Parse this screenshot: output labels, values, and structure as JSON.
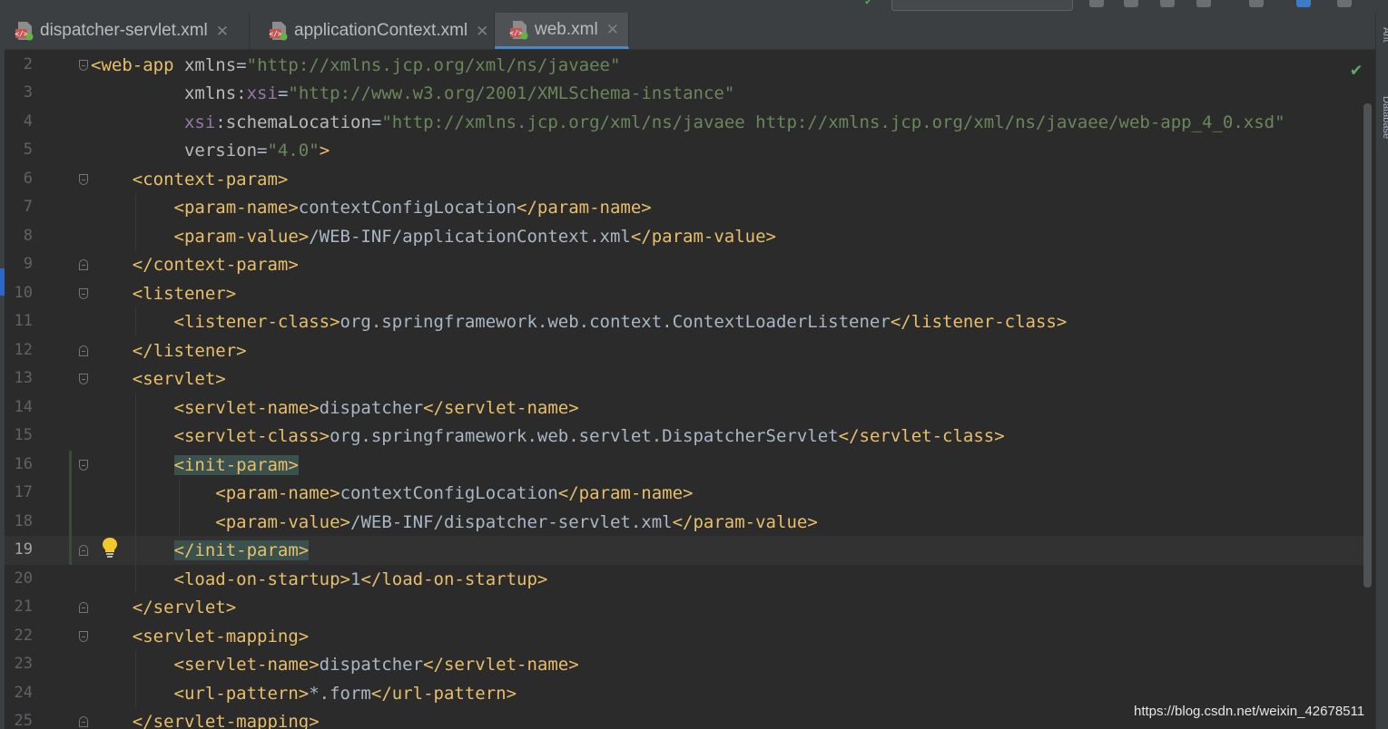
{
  "tabs": [
    {
      "label": "dispatcher-servlet.xml",
      "active": false,
      "close": "✕"
    },
    {
      "label": "applicationContext.xml",
      "active": false,
      "close": "✕"
    },
    {
      "label": "web.xml",
      "active": true,
      "close": "✕"
    }
  ],
  "right_strip": {
    "ant_label": "Ant",
    "database_label": "Database"
  },
  "editor": {
    "inspection_icon": "check-icon",
    "intention_icon": "lightbulb-icon",
    "caret_line": "19",
    "lines": [
      {
        "num": "2",
        "tokens": [
          {
            "t": "tag",
            "v": "<web-app"
          },
          {
            "t": "txt",
            "v": " "
          },
          {
            "t": "attr",
            "v": "xmlns"
          },
          {
            "t": "txt",
            "v": "="
          },
          {
            "t": "val",
            "v": "\"http://xmlns.jcp.org/xml/ns/javaee\""
          }
        ]
      },
      {
        "num": "3",
        "tokens": [
          {
            "t": "txt",
            "v": "         "
          },
          {
            "t": "attr",
            "v": "xmlns"
          },
          {
            "t": "txt",
            "v": ":"
          },
          {
            "t": "ns",
            "v": "xsi"
          },
          {
            "t": "txt",
            "v": "="
          },
          {
            "t": "val",
            "v": "\"http://www.w3.org/2001/XMLSchema-instance\""
          }
        ]
      },
      {
        "num": "4",
        "tokens": [
          {
            "t": "txt",
            "v": "         "
          },
          {
            "t": "ns",
            "v": "xsi"
          },
          {
            "t": "txt",
            "v": ":"
          },
          {
            "t": "attr",
            "v": "schemaLocation"
          },
          {
            "t": "txt",
            "v": "="
          },
          {
            "t": "val",
            "v": "\"http://xmlns.jcp.org/xml/ns/javaee http://xmlns.jcp.org/xml/ns/javaee/web-app_4_0.xsd\""
          }
        ]
      },
      {
        "num": "5",
        "tokens": [
          {
            "t": "txt",
            "v": "         "
          },
          {
            "t": "attr",
            "v": "version"
          },
          {
            "t": "txt",
            "v": "="
          },
          {
            "t": "val",
            "v": "\"4.0\""
          },
          {
            "t": "tag",
            "v": ">"
          }
        ]
      },
      {
        "num": "6",
        "tokens": [
          {
            "t": "txt",
            "v": "    "
          },
          {
            "t": "tag",
            "v": "<context-param>"
          }
        ]
      },
      {
        "num": "7",
        "tokens": [
          {
            "t": "txt",
            "v": "        "
          },
          {
            "t": "tag",
            "v": "<param-name>"
          },
          {
            "t": "txt",
            "v": "contextConfigLocation"
          },
          {
            "t": "tag",
            "v": "</param-name>"
          }
        ]
      },
      {
        "num": "8",
        "tokens": [
          {
            "t": "txt",
            "v": "        "
          },
          {
            "t": "tag",
            "v": "<param-value>"
          },
          {
            "t": "txt",
            "v": "/WEB-INF/applicationContext.xml"
          },
          {
            "t": "tag",
            "v": "</param-value>"
          }
        ]
      },
      {
        "num": "9",
        "tokens": [
          {
            "t": "txt",
            "v": "    "
          },
          {
            "t": "tag",
            "v": "</context-param>"
          }
        ]
      },
      {
        "num": "10",
        "tokens": [
          {
            "t": "txt",
            "v": "    "
          },
          {
            "t": "tag",
            "v": "<listener>"
          }
        ]
      },
      {
        "num": "11",
        "tokens": [
          {
            "t": "txt",
            "v": "        "
          },
          {
            "t": "tag",
            "v": "<listener-class>"
          },
          {
            "t": "txt",
            "v": "org.springframework.web.context.ContextLoaderListener"
          },
          {
            "t": "tag",
            "v": "</listener-class>"
          }
        ]
      },
      {
        "num": "12",
        "tokens": [
          {
            "t": "txt",
            "v": "    "
          },
          {
            "t": "tag",
            "v": "</listener>"
          }
        ]
      },
      {
        "num": "13",
        "tokens": [
          {
            "t": "txt",
            "v": "    "
          },
          {
            "t": "tag",
            "v": "<servlet>"
          }
        ]
      },
      {
        "num": "14",
        "tokens": [
          {
            "t": "txt",
            "v": "        "
          },
          {
            "t": "tag",
            "v": "<servlet-name>"
          },
          {
            "t": "txt",
            "v": "dispatcher"
          },
          {
            "t": "tag",
            "v": "</servlet-name>"
          }
        ]
      },
      {
        "num": "15",
        "tokens": [
          {
            "t": "txt",
            "v": "        "
          },
          {
            "t": "tag",
            "v": "<servlet-class>"
          },
          {
            "t": "txt",
            "v": "org.springframework.web.servlet.DispatcherServlet"
          },
          {
            "t": "tag",
            "v": "</servlet-class>"
          }
        ]
      },
      {
        "num": "16",
        "tokens": [
          {
            "t": "txt",
            "v": "        "
          },
          {
            "t": "tag",
            "v": "<init-param>",
            "hl": true
          }
        ]
      },
      {
        "num": "17",
        "tokens": [
          {
            "t": "txt",
            "v": "            "
          },
          {
            "t": "tag",
            "v": "<param-name>"
          },
          {
            "t": "txt",
            "v": "contextConfigLocation"
          },
          {
            "t": "tag",
            "v": "</param-name>"
          }
        ]
      },
      {
        "num": "18",
        "tokens": [
          {
            "t": "txt",
            "v": "            "
          },
          {
            "t": "tag",
            "v": "<param-value>"
          },
          {
            "t": "txt",
            "v": "/WEB-INF/dispatcher-servlet.xml"
          },
          {
            "t": "tag",
            "v": "</param-value>"
          }
        ]
      },
      {
        "num": "19",
        "tokens": [
          {
            "t": "txt",
            "v": "        "
          },
          {
            "t": "tag",
            "v": "</init-param>",
            "hl": true
          }
        ]
      },
      {
        "num": "20",
        "tokens": [
          {
            "t": "txt",
            "v": "        "
          },
          {
            "t": "tag",
            "v": "<load-on-startup>"
          },
          {
            "t": "txt",
            "v": "1"
          },
          {
            "t": "tag",
            "v": "</load-on-startup>"
          }
        ]
      },
      {
        "num": "21",
        "tokens": [
          {
            "t": "txt",
            "v": "    "
          },
          {
            "t": "tag",
            "v": "</servlet>"
          }
        ]
      },
      {
        "num": "22",
        "tokens": [
          {
            "t": "txt",
            "v": "    "
          },
          {
            "t": "tag",
            "v": "<servlet-mapping>"
          }
        ]
      },
      {
        "num": "23",
        "tokens": [
          {
            "t": "txt",
            "v": "        "
          },
          {
            "t": "tag",
            "v": "<servlet-name>"
          },
          {
            "t": "txt",
            "v": "dispatcher"
          },
          {
            "t": "tag",
            "v": "</servlet-name>"
          }
        ]
      },
      {
        "num": "24",
        "tokens": [
          {
            "t": "txt",
            "v": "        "
          },
          {
            "t": "tag",
            "v": "<url-pattern>"
          },
          {
            "t": "txt",
            "v": "*.form"
          },
          {
            "t": "tag",
            "v": "</url-pattern>"
          }
        ]
      },
      {
        "num": "25",
        "tokens": [
          {
            "t": "txt",
            "v": "    "
          },
          {
            "t": "tag",
            "v": "</servlet-mapping>"
          }
        ]
      }
    ]
  },
  "watermark": "https://blog.csdn.net/weixin_42678511"
}
